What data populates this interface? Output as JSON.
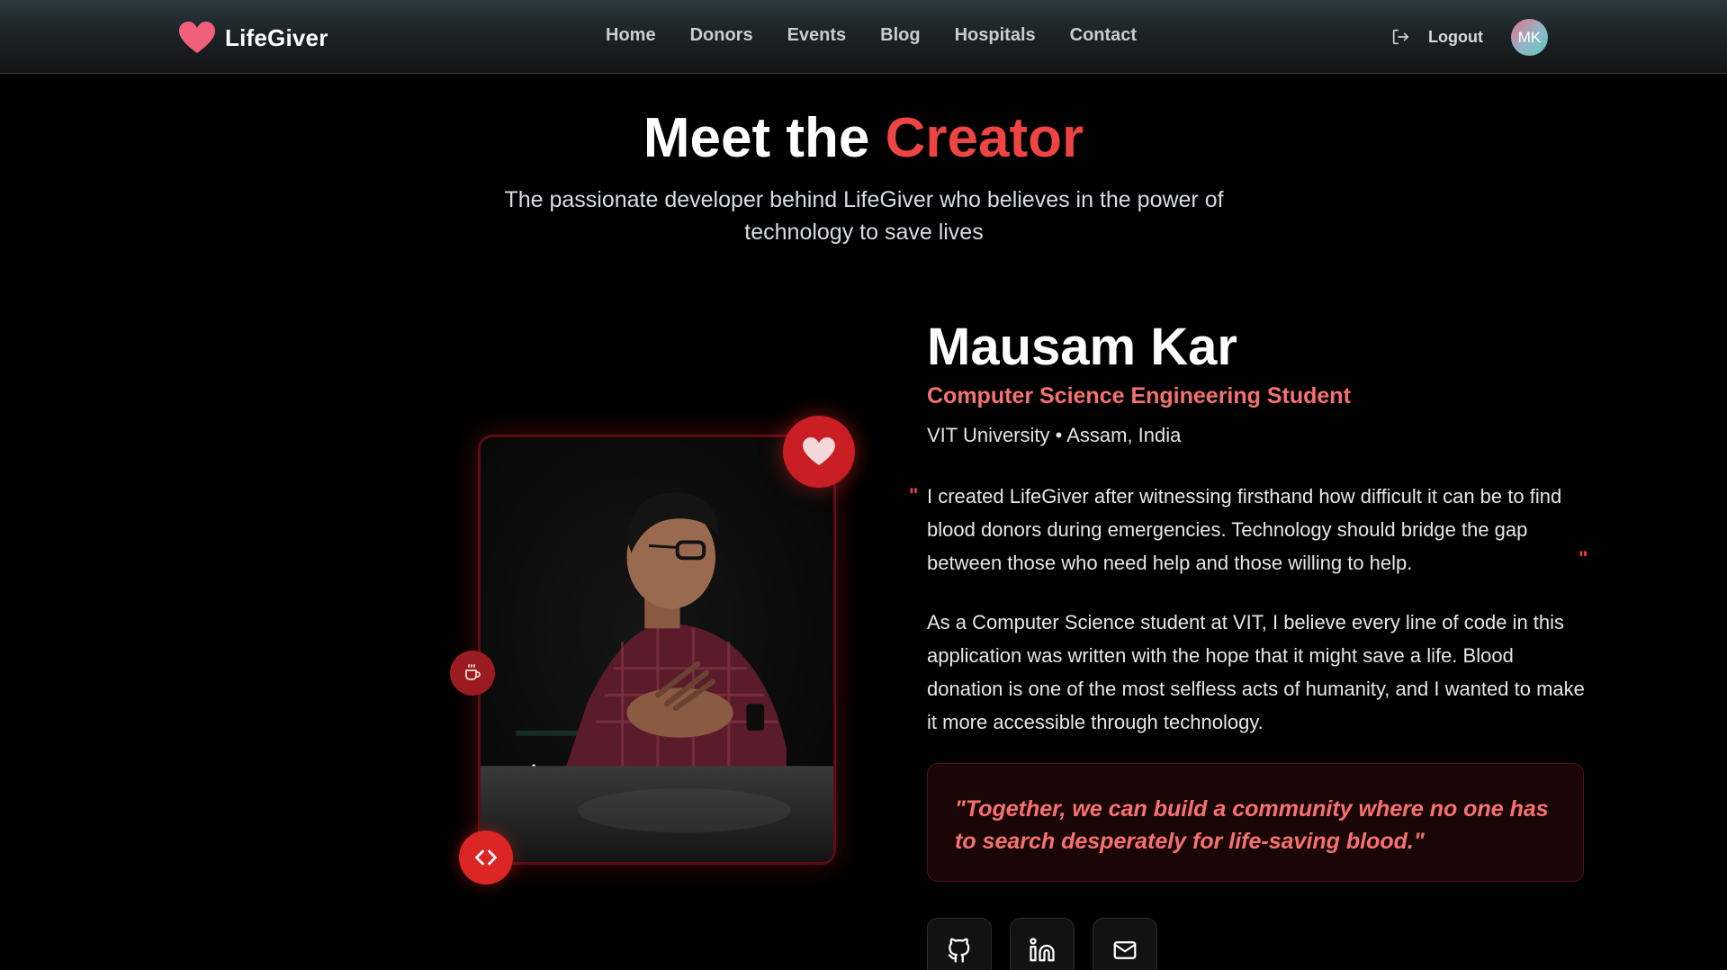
{
  "nav": {
    "brand": "LifeGiver",
    "brand_icon": "heart-icon",
    "links": [
      "Home",
      "Donors",
      "Events",
      "Blog",
      "Hospitals",
      "Contact"
    ],
    "logout_label": "Logout",
    "avatar_initials": "MK"
  },
  "hero": {
    "title_prefix": "Meet the",
    "title_accent": "Creator",
    "subtitle": "The passionate developer behind LifeGiver who believes in the power of technology to save lives"
  },
  "profile": {
    "photo_alt": "photo",
    "badges": [
      "heart-icon",
      "coffee-icon",
      "code-icon"
    ],
    "name": "Mausam Kar",
    "role": "Computer Science Engineering Student",
    "location": "VIT University • Assam, India",
    "quote_mark_open": "\"",
    "quote_mark_close": "\"",
    "quote": "I created LifeGiver after witnessing firsthand how difficult it can be to find blood donors during emergencies. Technology should bridge the gap between those who need help and those willing to help.",
    "paragraph": "As a Computer Science student at VIT, I believe every line of code in this application was written with the hope that it might save a life. Blood donation is one of the most selfless acts of humanity, and I wanted to make it more accessible through technology.",
    "motto": "\"Together, we can build a community where no one has to search desperately for life-saving blood.\"",
    "socials": [
      "github-icon",
      "linkedin-icon",
      "mail-icon"
    ]
  },
  "colors": {
    "accent": "#ef4444",
    "accent_light": "#f87171",
    "background": "#000000",
    "brand_heart": "#f0607a"
  }
}
